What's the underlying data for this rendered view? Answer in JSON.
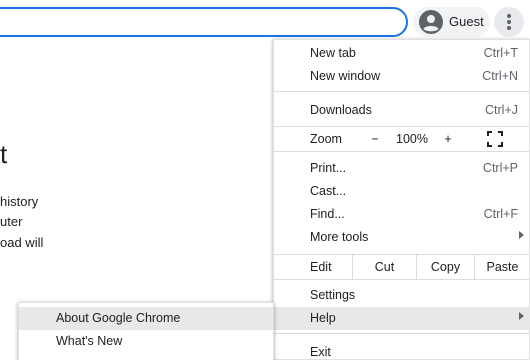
{
  "toolbar": {
    "profile_label": "Guest"
  },
  "page": {
    "heading": "t",
    "lines": [
      "history",
      "uter",
      "oad will"
    ]
  },
  "menu": {
    "new_tab": {
      "label": "New tab",
      "shortcut": "Ctrl+T"
    },
    "new_window": {
      "label": "New window",
      "shortcut": "Ctrl+N"
    },
    "downloads": {
      "label": "Downloads",
      "shortcut": "Ctrl+J"
    },
    "zoom": {
      "label": "Zoom",
      "minus": "−",
      "level": "100%",
      "plus": "+"
    },
    "print": {
      "label": "Print...",
      "shortcut": "Ctrl+P"
    },
    "cast": {
      "label": "Cast..."
    },
    "find": {
      "label": "Find...",
      "shortcut": "Ctrl+F"
    },
    "more_tools": {
      "label": "More tools"
    },
    "edit": {
      "label": "Edit",
      "cut": "Cut",
      "copy": "Copy",
      "paste": "Paste"
    },
    "settings": {
      "label": "Settings"
    },
    "help": {
      "label": "Help"
    },
    "exit": {
      "label": "Exit"
    }
  },
  "help_submenu": {
    "about": "About Google Chrome",
    "whats_new": "What's New"
  },
  "colors": {
    "focus_blue": "#1a73e8",
    "highlight": "#e8e8e8",
    "separator": "#dadce0"
  }
}
